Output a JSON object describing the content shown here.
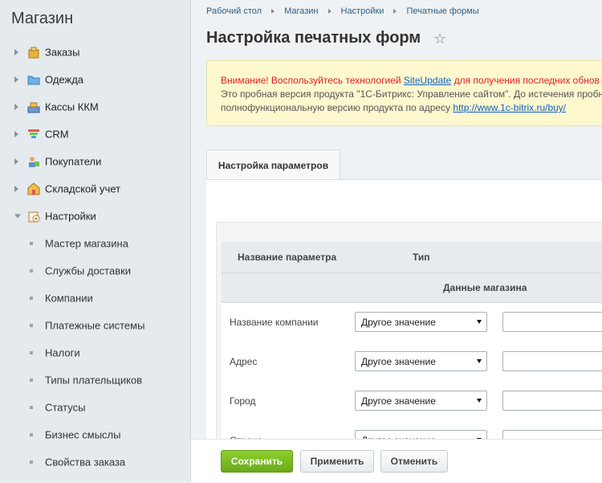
{
  "sidebar": {
    "title": "Магазин",
    "items": [
      {
        "label": "Заказы",
        "icon": "orders-icon"
      },
      {
        "label": "Одежда",
        "icon": "folder-icon"
      },
      {
        "label": "Кассы ККМ",
        "icon": "cash-register-icon"
      },
      {
        "label": "CRM",
        "icon": "crm-funnel-icon"
      },
      {
        "label": "Покупатели",
        "icon": "customers-icon"
      },
      {
        "label": "Складской учет",
        "icon": "warehouse-icon"
      },
      {
        "label": "Настройки",
        "icon": "settings-icon"
      }
    ],
    "subitems": [
      "Мастер магазина",
      "Службы доставки",
      "Компании",
      "Платежные системы",
      "Налоги",
      "Типы плательщиков",
      "Статусы",
      "Бизнес смыслы",
      "Свойства заказа"
    ]
  },
  "breadcrumb": [
    "Рабочий стол",
    "Магазин",
    "Настройки",
    "Печатные формы"
  ],
  "page": {
    "title": "Настройка печатных форм"
  },
  "notice": {
    "line1_prefix": "Внимание! Воспользуйтесь технологией ",
    "line1_link": "SiteUpdate",
    "line1_suffix": " для получения последних обнов",
    "line2": "Это пробная версия продукта \"1С-Битрикс: Управление сайтом\". До истечения пробн",
    "line3_prefix": "полнофункциональную версию продукта по адресу ",
    "line3_link": "http://www.1c-bitrix.ru/buy/"
  },
  "tab": {
    "label": "Настройка параметров"
  },
  "table": {
    "col_name": "Название параметра",
    "col_type": "Тип",
    "group": "Данные магазина",
    "rows": [
      {
        "name": "Название компании",
        "type": "Другое значение"
      },
      {
        "name": "Адрес",
        "type": "Другое значение"
      },
      {
        "name": "Город",
        "type": "Другое значение"
      },
      {
        "name": "Страна",
        "type": "Другое значение"
      }
    ]
  },
  "buttons": {
    "save": "Сохранить",
    "apply": "Применить",
    "cancel": "Отменить"
  },
  "colors": {
    "save_green": "#6aaa1a",
    "notice_bg": "#fef8cf",
    "link_blue": "#1060c0",
    "warning_red": "#e02020"
  }
}
